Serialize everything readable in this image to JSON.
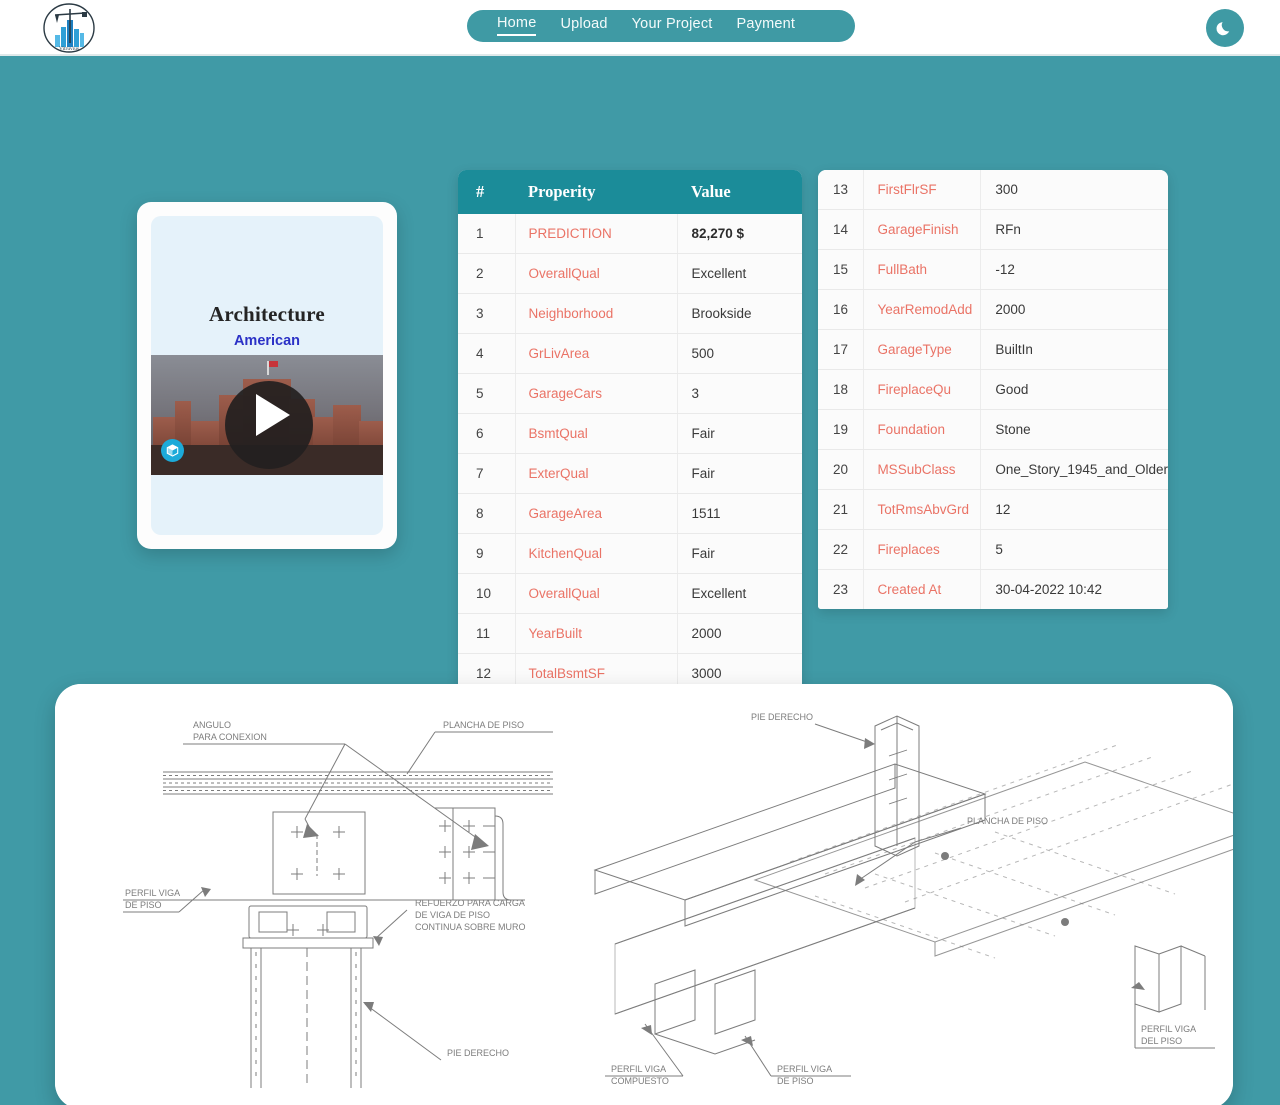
{
  "navbar": {
    "brand_name": "Vitruvius",
    "links": [
      {
        "label": "Home",
        "active": true
      },
      {
        "label": "Upload",
        "active": false
      },
      {
        "label": "Your Project",
        "active": false
      },
      {
        "label": "Payment",
        "active": false
      }
    ],
    "theme_toggle_icon": "moon-icon"
  },
  "model_card": {
    "title": "Architecture",
    "subtitle": "American",
    "embed_provider_icon": "sketchfab-icon",
    "play_icon": "play-icon"
  },
  "result_table": {
    "headers": {
      "index": "#",
      "property": "Properity",
      "value": "Value"
    },
    "left_rows": [
      {
        "idx": "1",
        "property": "PREDICTION",
        "value": "82,270 $",
        "bold": true
      },
      {
        "idx": "2",
        "property": "OverallQual",
        "value": "Excellent",
        "bold": false
      },
      {
        "idx": "3",
        "property": "Neighborhood",
        "value": "Brookside",
        "bold": false
      },
      {
        "idx": "4",
        "property": "GrLivArea",
        "value": "500",
        "bold": false
      },
      {
        "idx": "5",
        "property": "GarageCars",
        "value": "3",
        "bold": false
      },
      {
        "idx": "6",
        "property": "BsmtQual",
        "value": "Fair",
        "bold": false
      },
      {
        "idx": "7",
        "property": "ExterQual",
        "value": "Fair",
        "bold": false
      },
      {
        "idx": "8",
        "property": "GarageArea",
        "value": "1511",
        "bold": false
      },
      {
        "idx": "9",
        "property": "KitchenQual",
        "value": "Fair",
        "bold": false
      },
      {
        "idx": "10",
        "property": "OverallQual",
        "value": "Excellent",
        "bold": false
      },
      {
        "idx": "11",
        "property": "YearBuilt",
        "value": "2000",
        "bold": false
      },
      {
        "idx": "12",
        "property": "TotalBsmtSF",
        "value": "3000",
        "bold": false
      }
    ],
    "right_rows": [
      {
        "idx": "13",
        "property": "FirstFlrSF",
        "value": "300"
      },
      {
        "idx": "14",
        "property": "GarageFinish",
        "value": "RFn"
      },
      {
        "idx": "15",
        "property": "FullBath",
        "value": "-12"
      },
      {
        "idx": "16",
        "property": "YearRemodAdd",
        "value": "2000"
      },
      {
        "idx": "17",
        "property": "GarageType",
        "value": "BuiltIn"
      },
      {
        "idx": "18",
        "property": "FireplaceQu",
        "value": "Good"
      },
      {
        "idx": "19",
        "property": "Foundation",
        "value": "Stone"
      },
      {
        "idx": "20",
        "property": "MSSubClass",
        "value": "One_Story_1945_and_Older"
      },
      {
        "idx": "21",
        "property": "TotRmsAbvGrd",
        "value": "12"
      },
      {
        "idx": "22",
        "property": "Fireplaces",
        "value": "5"
      },
      {
        "idx": "23",
        "property": "Created At",
        "value": "30-04-2022 10:42"
      }
    ]
  },
  "blueprint": {
    "labels": [
      "ANGULO PARA CONEXION",
      "PLANCHA DE PISO",
      "PERFIL VIGA DE PISO",
      "REFUERZO PARA CARGA DE VIGA DE PISO CONTINUA SOBRE MURO",
      "PIE DERECHO",
      "PERFIL VIGA COMPUESTO",
      "PIE DERECHO",
      "PLANCHA DE PISO",
      "PERFIL VIGA DE PISO",
      "PERFIL VIGA DEL PISO"
    ]
  },
  "colors": {
    "page_background": "#409aa6",
    "navbar_background": "#ffffff",
    "nav_pill": "#3f9aa4",
    "table_header": "#1b8c99",
    "property_text": "#ea7366",
    "subtitle_text": "#2b31c6",
    "sketchfab_blue": "#1caad9"
  }
}
